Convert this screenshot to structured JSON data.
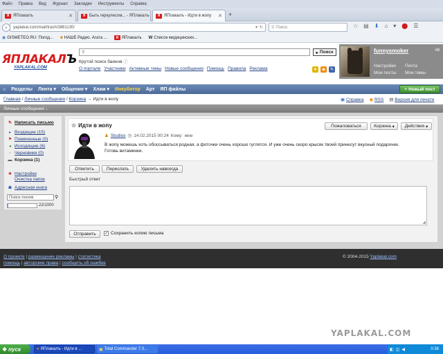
{
  "browser": {
    "menu": [
      "Файл",
      "Правка",
      "Вид",
      "Журнал",
      "Закладки",
      "Инструменты",
      "Справка"
    ],
    "tabs": [
      {
        "label": "ЯПлакалъ"
      },
      {
        "label": "Быть геркулесом... - ЯПлакалъ"
      },
      {
        "label": "ЯПлакалъ - Идти в жопу"
      }
    ],
    "new_tab": "+",
    "url": "yaplakal.com/mail/trash/3861130/",
    "search_placeholder": "Поиск",
    "bookmarks": [
      "GISMETEO.RU: Погод...",
      "НАШЕ Радио. Агата ...",
      "ЯПлакалъ",
      "Список медицинских..."
    ]
  },
  "site": {
    "logo_main": "ЯПЛАКАЛ",
    "logo_tail": "Ъ",
    "logo_sub": "YAPLAKAL.COM",
    "search_button": "Поиск",
    "slogan": "Крутой поиск баянов",
    "links": [
      "О портале",
      "Участники",
      "Активные темы",
      "Новые сообщения",
      "Помощь",
      "Правила",
      "Реклама"
    ],
    "user": {
      "name": "funnysmoker",
      "hash": "#8",
      "settings": "Настройки",
      "mail": "Почта",
      "my_posts": "Мои посты",
      "my_topics": "Мои темы"
    }
  },
  "mainnav": {
    "items": [
      "Разделы",
      "Лента",
      "Общение",
      "Хлам",
      "Инкубатор",
      "Арт",
      "ЯП файлы"
    ],
    "new_post": "Новый пост"
  },
  "breadcrumb": {
    "home": "Главная",
    "sep1": "/",
    "pm": "Личные сообщения",
    "sep2": "/",
    "trash": "Корзина",
    "arrow": "→",
    "current": "Идти в жопу"
  },
  "toplinks": {
    "help": "Справка",
    "rss": "RSS",
    "print": "Версия для печати"
  },
  "section_title": "Личные сообщения",
  "section_arrow": "↓",
  "sidebar": {
    "compose": "Написать письмо",
    "folders": [
      {
        "label": "Входящие (15)"
      },
      {
        "label": "Помеченные (0)"
      },
      {
        "label": "Исходящие (6)"
      },
      {
        "label": "Черновики (0)"
      },
      {
        "label": "Корзина (1)"
      }
    ],
    "settings": "Настройки",
    "clean": "Очистка папок",
    "addressbook": "Адресная книга",
    "search_placeholder": "Поиск писем",
    "quota_text": "22/1000",
    "quota_fraction": 0.022
  },
  "message": {
    "title": "Идти в жопу",
    "buttons": {
      "complain": "Пожаловаться",
      "trash": "Корзина",
      "actions": "Действия"
    },
    "from": "Studios",
    "date": "14.02.2015 00:24",
    "to_label": "Кому:",
    "to_value": "мне",
    "body_line1": "В жопу можешь хоть обоссываться родная, а фоточки очень хорошо гуглятся. И уже очень скоро крысяк твоей принесут вкусный подарочек.",
    "body_line2": "Готовь витаминки."
  },
  "actions": {
    "reply": "Ответить",
    "forward": "Переслать",
    "delete": "Удалить навсегда"
  },
  "quick": {
    "label": "Быстрый ответ",
    "send": "Отправить",
    "save_copy": "Сохранить копию письма"
  },
  "footer": {
    "about": "О проекте",
    "ads": "размещение рекламы",
    "stats": "статистика",
    "help": "помощь",
    "copyright_link": "авторские права",
    "report": "сообщить об ошибке",
    "copyright_text": "© 2004-2015",
    "copyright_site": "Yaplakal.com"
  },
  "watermark": "YAPLAKAL.COM",
  "taskbar": {
    "start": "пуск",
    "tasks": [
      "ЯПлакалъ - Идти в ...",
      "Total Commander 7.0..."
    ],
    "clock": "0:38"
  },
  "colors": {
    "brand_red": "#d81a1a",
    "nav_blue": "#5677a8",
    "link": "#1f3f80",
    "new_post_green": "#3f8f2f"
  }
}
